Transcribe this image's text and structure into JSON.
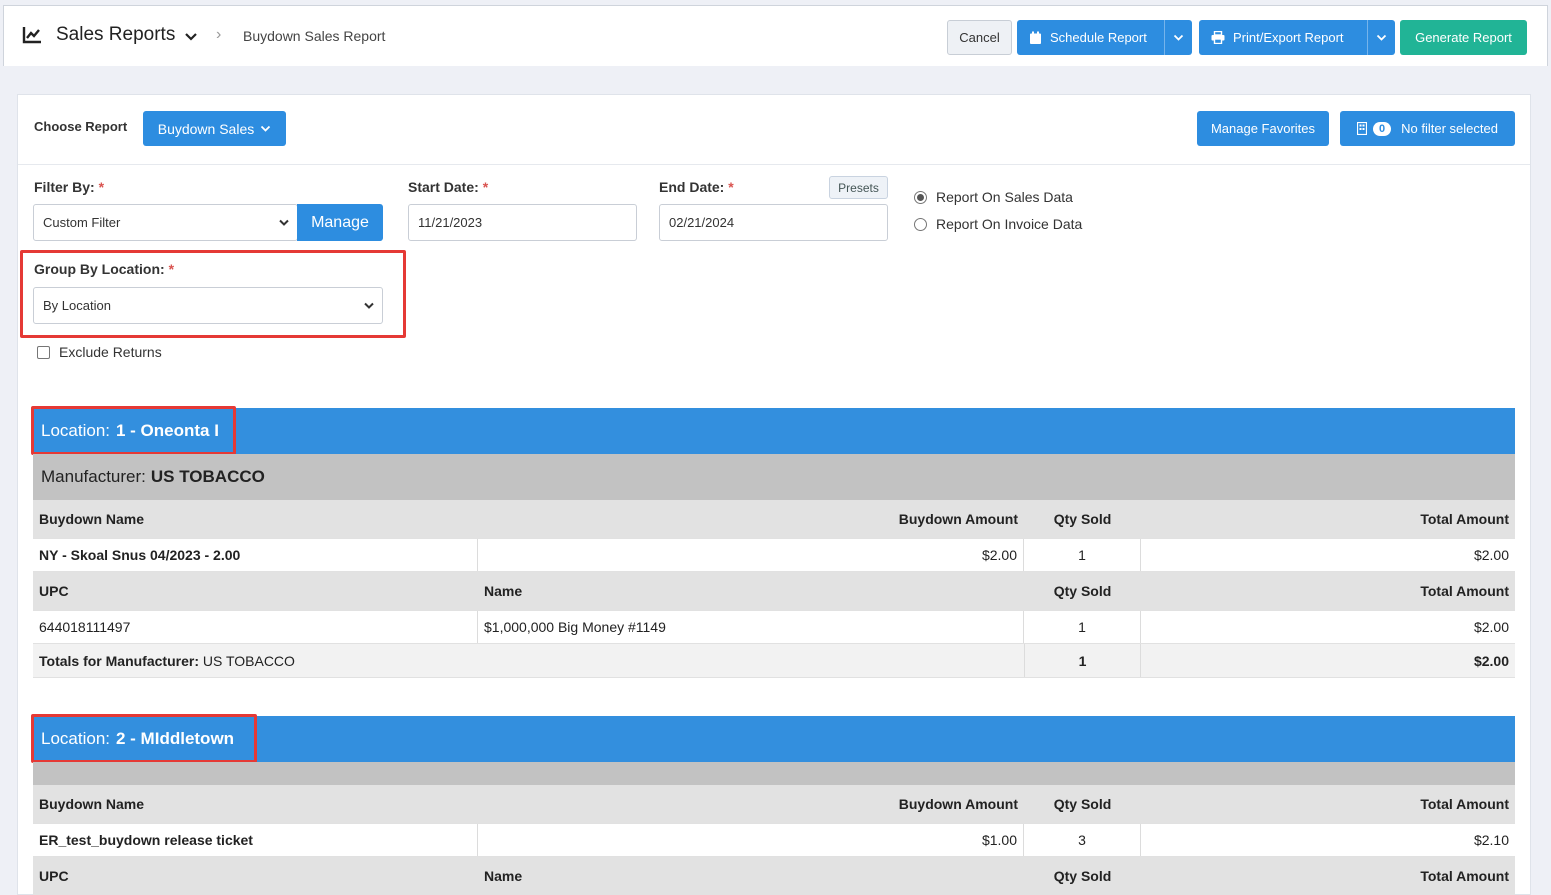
{
  "header": {
    "title": "Sales Reports",
    "breadcrumb": "Buydown Sales Report",
    "cancel": "Cancel",
    "schedule": "Schedule Report",
    "print": "Print/Export Report",
    "generate": "Generate Report"
  },
  "report_picker": {
    "label": "Choose Report",
    "selected": "Buydown Sales",
    "manage_favorites": "Manage Favorites",
    "filter_count": "0",
    "filter_text": "No filter selected"
  },
  "filters": {
    "filter_by_label": "Filter By:",
    "filter_by_value": "Custom Filter",
    "manage": "Manage",
    "start_label": "Start Date:",
    "start_value": "11/21/2023",
    "end_label": "End Date:",
    "end_value": "02/21/2024",
    "presets": "Presets",
    "radio_sales": "Report On Sales Data",
    "radio_invoice": "Report On Invoice Data",
    "group_label": "Group By Location:",
    "group_value": "By Location",
    "exclude_returns": "Exclude Returns",
    "required_mark": "*"
  },
  "report": {
    "loc_prefix": "Location:",
    "mfr_prefix": "Manufacturer:",
    "totals_prefix": "Totals for Manufacturer:",
    "cols_buydown": [
      "Buydown Name",
      "Buydown Amount",
      "Qty Sold",
      "Total Amount"
    ],
    "cols_upc": [
      "UPC",
      "Name",
      "Qty Sold",
      "Total Amount"
    ],
    "locations": [
      {
        "name": "1 - Oneonta I",
        "manufacturer": "US TOBACCO",
        "buydown": {
          "name": "NY - Skoal Snus 04/2023 - 2.00",
          "amount": "$2.00",
          "qty": "1",
          "total": "$2.00"
        },
        "item": {
          "upc": "644018111497",
          "name": "$1,000,000 Big Money #1149",
          "qty": "1",
          "total": "$2.00"
        },
        "totals": {
          "manufacturer": "US TOBACCO",
          "qty": "1",
          "total": "$2.00"
        }
      },
      {
        "name": "2 - MIddletown",
        "manufacturer": "",
        "buydown": {
          "name": "ER_test_buydown release ticket",
          "amount": "$1.00",
          "qty": "3",
          "total": "$2.10"
        }
      }
    ]
  }
}
